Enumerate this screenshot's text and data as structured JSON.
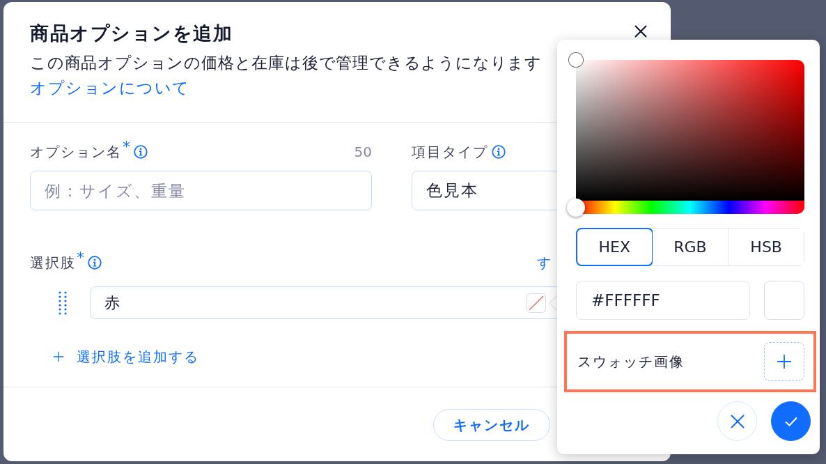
{
  "dialog": {
    "title": "商品オプションを追加",
    "description": "この商品オプションの価格と在庫は後で管理できるようになります",
    "help_link": "オプションについて",
    "fields": [
      {
        "label": "オプション名",
        "required_mark": "*",
        "counter": "50",
        "placeholder": "例：サイズ、重量"
      },
      {
        "label": "項目タイプ",
        "value": "色見本"
      }
    ],
    "choices": {
      "label": "選択肢",
      "required_mark": "*",
      "link": "す",
      "items": [
        {
          "value": "赤"
        }
      ],
      "add_button": "選択肢を追加する"
    },
    "footer_buttons": [
      "キャンセル"
    ]
  },
  "color_picker": {
    "hue_slider": {
      "level": 0
    },
    "modes": [
      {
        "label": "HEX",
        "selected": true
      },
      {
        "label": "RGB",
        "selected": false
      },
      {
        "label": "HSB",
        "selected": false
      }
    ],
    "hex_value": "#FFFFFF",
    "swatch_image": {
      "label": "スウォッチ画像",
      "highlighted": true
    }
  }
}
